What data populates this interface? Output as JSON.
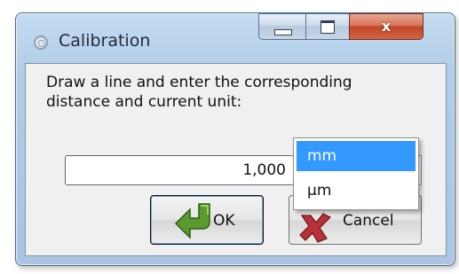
{
  "window": {
    "title": "Calibration",
    "close_glyph": "x"
  },
  "dialog": {
    "prompt": "Draw a line and enter the corresponding\ndistance and current unit:",
    "distance_value": "1,000",
    "unit_selected": "mm",
    "unit_options": [
      "mm",
      "µm"
    ],
    "ok_label": "OK",
    "cancel_label": "Cancel"
  },
  "colors": {
    "selection": "#3399ff",
    "ok_icon": "#5a9a2e",
    "cancel_icon": "#b8323a"
  },
  "icons": {
    "title": "app-circle-icon",
    "ok": "green-arrow-icon",
    "cancel": "red-x-icon"
  }
}
